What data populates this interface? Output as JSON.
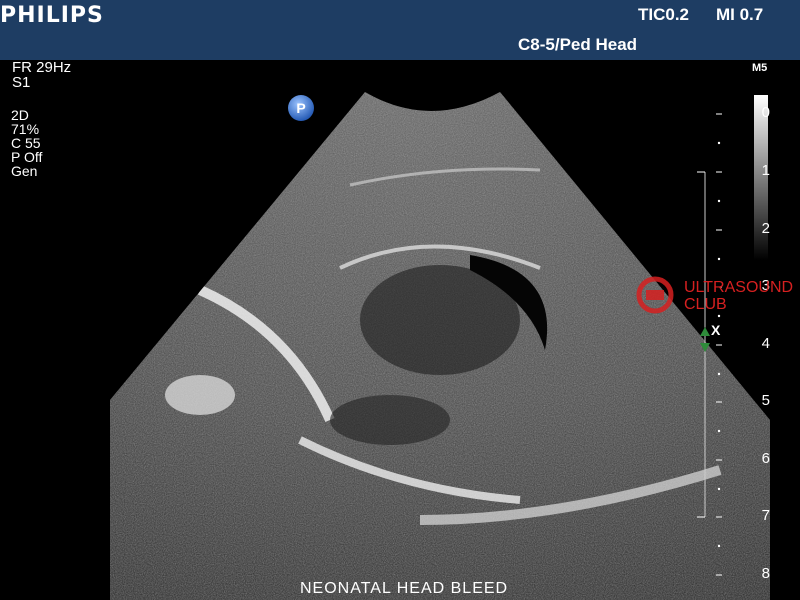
{
  "header": {
    "brand": "PHILIPS",
    "tic": "TIC0.2",
    "mi": "MI 0.7",
    "probe_preset": "C8-5/Ped Head"
  },
  "params": {
    "frame_rate": "FR 29Hz",
    "s": "S1",
    "mode": "2D",
    "gain": "71%",
    "contrast": "C 55",
    "persistence": "P Off",
    "resolution": "Gen"
  },
  "badge": "P",
  "grayscale_label": "M5",
  "depth_scale": [
    "0",
    "1",
    "2",
    "3",
    "4",
    "5",
    "6",
    "7",
    "8"
  ],
  "focus_marker": "X",
  "watermark": {
    "line1": "ULTRASOUND",
    "line2": "CLUB"
  },
  "caption": "NEONATAL HEAD BLEED",
  "colors": {
    "header_bg": "#1e3d63",
    "focus_marker": "#2e8b3a",
    "watermark": "#d62020"
  }
}
